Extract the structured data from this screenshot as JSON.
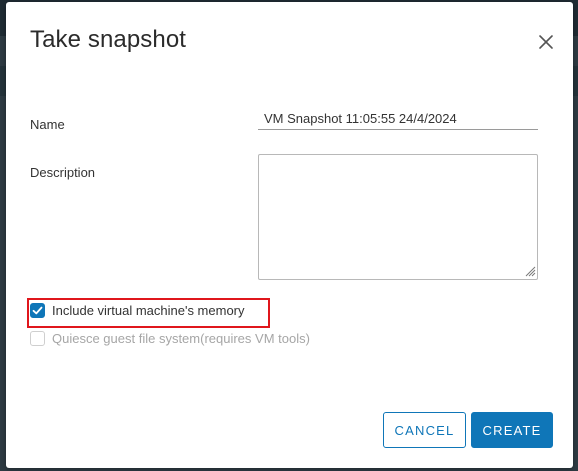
{
  "dialog": {
    "title": "Take snapshot",
    "close_icon": "close-icon"
  },
  "form": {
    "name_label": "Name",
    "name_value": "VM Snapshot 11:05:55 24/4/2024",
    "description_label": "Description",
    "description_value": "",
    "include_memory": {
      "label": "Include virtual machine's memory",
      "checked": true,
      "enabled": true
    },
    "quiesce": {
      "label": "Quiesce guest file system(requires VM tools)",
      "checked": false,
      "enabled": false
    }
  },
  "buttons": {
    "cancel_label": "CANCEL",
    "create_label": "CREATE"
  },
  "colors": {
    "accent": "#0f76b8",
    "highlight": "#e0161c",
    "disabled_text": "#a6a6a6"
  }
}
